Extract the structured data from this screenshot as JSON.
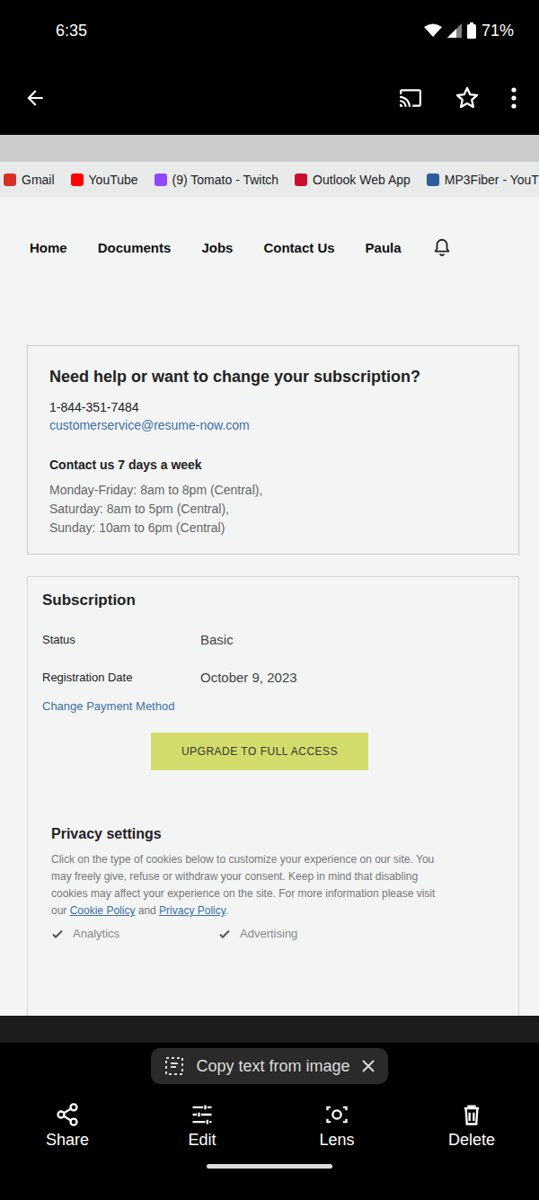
{
  "status_bar": {
    "time": "6:35",
    "battery": "71%"
  },
  "browser": {
    "bookmarks": [
      {
        "label": "Gmail",
        "color": "#d93025"
      },
      {
        "label": "YouTube",
        "color": "#ff0000"
      },
      {
        "label": "(9) Tomato - Twitch",
        "color": "#9146ff"
      },
      {
        "label": "Outlook Web App",
        "color": "#c8102e"
      },
      {
        "label": "MP3Fiber - YouT",
        "color": "#2f5e9e"
      }
    ]
  },
  "nav": {
    "items": [
      "Home",
      "Documents",
      "Jobs",
      "Contact Us"
    ],
    "user": "Paula"
  },
  "help_card": {
    "title": "Need help or want to change your subscription?",
    "phone": "1-844-351-7484",
    "email": "customerservice@resume-now.com",
    "subtitle": "Contact us 7 days a week",
    "hours": [
      "Monday-Friday: 8am to 8pm (Central),",
      "Saturday: 8am to 5pm (Central),",
      "Sunday: 10am to 6pm (Central)"
    ]
  },
  "subscription": {
    "title": "Subscription",
    "rows": [
      {
        "label": "Status",
        "value": "Basic"
      },
      {
        "label": "Registration Date",
        "value": "October 9, 2023"
      }
    ],
    "link": "Change Payment Method",
    "button": "UPGRADE TO FULL ACCESS"
  },
  "privacy": {
    "title": "Privacy settings",
    "text": "Click on the type of cookies below to customize your experience on our site. You may freely give, refuse or withdraw your consent. Keep in mind that disabling cookies may affect your experience on the site. For more information please visit our",
    "link1": "Cookie Policy",
    "between": "and",
    "link2": "Privacy Policy",
    "end": ".",
    "options": [
      {
        "label": "Analytics",
        "checked": true
      },
      {
        "label": "Advertising",
        "checked": true
      }
    ]
  },
  "chip": {
    "label": "Copy text from image"
  },
  "actions": [
    "Share",
    "Edit",
    "Lens",
    "Delete"
  ]
}
